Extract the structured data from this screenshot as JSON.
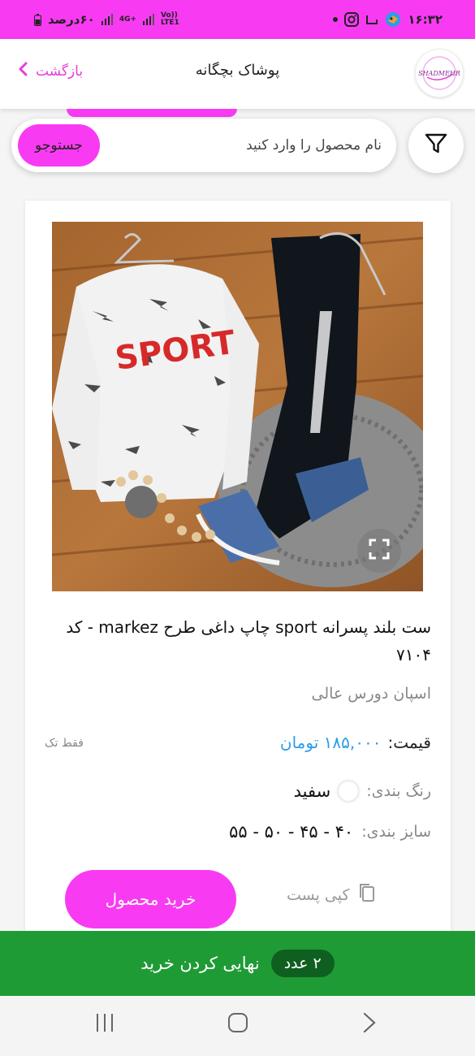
{
  "status_bar": {
    "time": "۱۶:۳۲",
    "battery_text": "۶۰درصد",
    "network_4g": "4G+",
    "network_volte": "Vo)) LTE1"
  },
  "header": {
    "logo_text": "SHADMEHR",
    "title": "پوشاک بچگانه",
    "back_label": "بازگشت"
  },
  "search": {
    "placeholder": "نام محصول را وارد کنید",
    "button_label": "جستوجو"
  },
  "product": {
    "title": "ست بلند پسرانه sport چاپ داغی طرح markez - کد ۷۱۰۴",
    "subtitle": "اسپان دورس عالی",
    "price_label": "قیمت:",
    "price_value": "۱۸۵,۰۰۰ تومان",
    "stock_note": "فقط تک",
    "color_label": "رنگ بندی:",
    "color_value": "سفید",
    "size_label": "سایز بندی:",
    "size_value": "۴۰ - ۴۵ - ۵۰ - ۵۵",
    "copy_label": "کپی پست",
    "buy_label": "خرید محصول",
    "image_print_text": "SPORT"
  },
  "checkout": {
    "count": "۲ عدد",
    "label": "نهایی کردن خرید"
  },
  "colors": {
    "accent": "#f83bf2",
    "price": "#2a9ee8",
    "checkout": "#1f9b35"
  }
}
